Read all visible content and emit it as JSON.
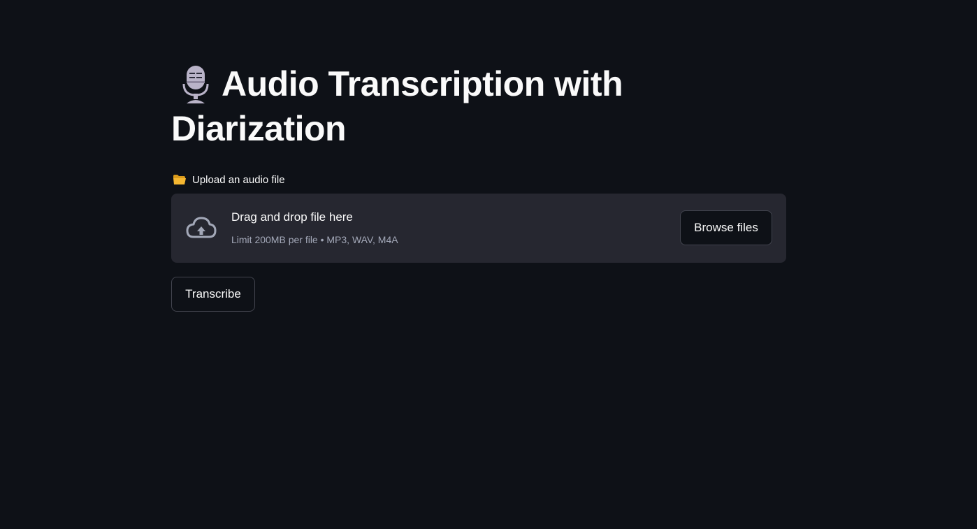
{
  "header": {
    "title": "Audio Transcription with Diarization",
    "title_icon": "microphone-icon"
  },
  "uploader": {
    "label": "Upload an audio file",
    "label_icon": "folder-icon",
    "drop_title": "Drag and drop file here",
    "limit_text": "Limit 200MB per file • MP3, WAV, M4A",
    "upload_icon": "cloud-upload-icon",
    "browse_label": "Browse files"
  },
  "actions": {
    "transcribe_label": "Transcribe"
  },
  "colors": {
    "background": "#0e1117",
    "panel": "#262730",
    "text": "#fafafa",
    "muted_text": "#a3a8b8",
    "border": "#42444e",
    "folder": "#f5b731"
  }
}
